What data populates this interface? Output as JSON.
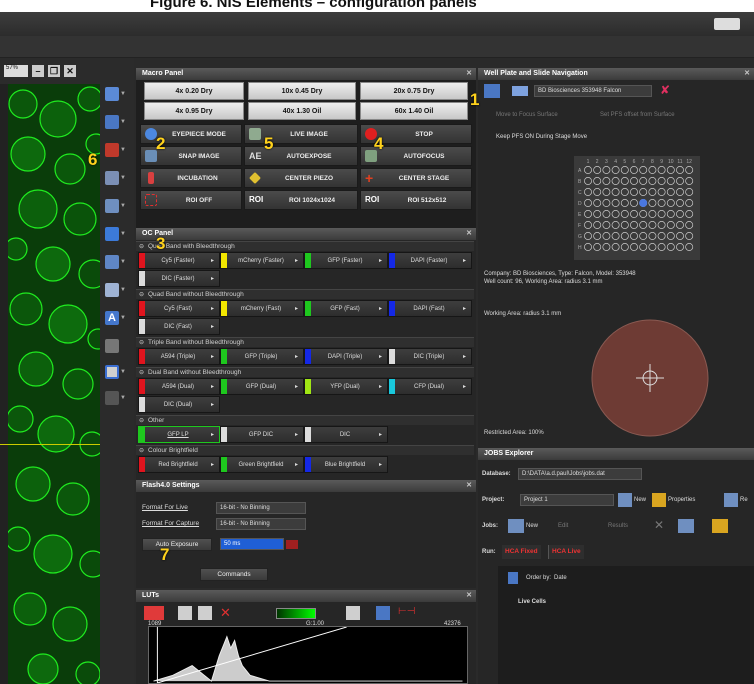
{
  "page_title": "Figure 6. NIS Elements – configuration panels",
  "viewer": {
    "zoom": "57%"
  },
  "macro_panel": {
    "title": "Macro Panel",
    "objectives": [
      "4x 0.20 Dry",
      "10x 0.45 Dry",
      "20x 0.75 Dry",
      "4x 0.95 Dry",
      "40x 1.30 Oil",
      "60x 1.40 Oil"
    ],
    "buttons": [
      "EYEPIECE MODE",
      "LIVE IMAGE",
      "STOP",
      "SNAP IMAGE",
      "AUTOEXPOSE",
      "AUTOFOCUS",
      "INCUBATION",
      "CENTER PIEZO",
      "CENTER STAGE",
      "ROI OFF",
      "ROI 1024x1024",
      "ROI 512x512"
    ]
  },
  "oc_panel": {
    "title": "OC Panel",
    "groups": [
      {
        "name": "Quad Band with Bleedthrough",
        "channels": [
          "Cy5 (Faster)",
          "mCherry (Faster)",
          "GFP (Faster)",
          "DAPI (Faster)",
          "DIC (Faster)"
        ]
      },
      {
        "name": "Quad Band without Bleedthrough",
        "channels": [
          "Cy5 (Fast)",
          "mCherry (Fast)",
          "GFP (Fast)",
          "DAPI (Fast)",
          "DIC (Fast)"
        ]
      },
      {
        "name": "Triple Band without Bleedthrough",
        "channels": [
          "A594 (Triple)",
          "GFP (Triple)",
          "DAPI (Triple)",
          "DIC (Triple)"
        ]
      },
      {
        "name": "Dual Band without Bleedthrough",
        "channels": [
          "A594 (Dual)",
          "GFP (Dual)",
          "YFP (Dual)",
          "CFP (Dual)",
          "DIC (Dual)"
        ]
      },
      {
        "name": "Other",
        "channels": [
          "GFP LP",
          "GFP DIC",
          "DIC"
        ]
      },
      {
        "name": "Colour Brightfield",
        "channels": [
          "Red Brightfield",
          "Green Brightfield",
          "Blue Brightfield"
        ]
      }
    ]
  },
  "flash_settings": {
    "title": "Flash4.0 Settings",
    "format_live_label": "Format For Live",
    "format_live_value": "16-bit - No Binning",
    "format_capture_label": "Format For Capture",
    "format_capture_value": "16-bit - No Binning",
    "auto_exposure": "Auto Exposure",
    "exposure_value": "50 ms",
    "commands": "Commands"
  },
  "luts": {
    "title": "LUTs",
    "min": "1089",
    "gamma": "G:1.00",
    "max": "42376"
  },
  "well_plate": {
    "title": "Well Plate and Slide Navigation",
    "plate_select": "BD Biosciences 353948 Falcon",
    "move_to_focus": "Move to Focus Surface",
    "set_pfs": "Set PFS offset from Surface",
    "keep_pfs": "Keep PFS ON During Stage Move",
    "col_labels": [
      "1",
      "2",
      "3",
      "4",
      "5",
      "6",
      "7",
      "8",
      "9",
      "10",
      "11",
      "12"
    ],
    "row_labels": [
      "A",
      "B",
      "C",
      "D",
      "E",
      "F",
      "G",
      "H"
    ],
    "company": "Company: BD Biosciences, Type: Falcon, Model: 353948",
    "well_info": "Well count: 96, Working Area: radius 3.1 mm",
    "working_area": "Working Area: radius 3.1 mm",
    "restricted_area": "Restricted Area: 100%"
  },
  "jobs": {
    "title": "JOBS Explorer",
    "database_label": "Database:",
    "database_value": "D:\\DATA\\a.d.paul\\Jobs\\jobs.dat",
    "project_label": "Project:",
    "project_value": "Project 1",
    "new": "New",
    "properties": "Properties",
    "re": "Re",
    "jobs_label": "Jobs:",
    "edit": "Edit",
    "results": "Results",
    "run_label": "Run:",
    "tab_fixed": "HCA Fixed",
    "tab_live": "HCA Live",
    "order_by": "Order by:",
    "order_value": "Date",
    "group": "Live Cells"
  },
  "annotations": [
    "1",
    "2",
    "3",
    "4",
    "5",
    "6",
    "7"
  ],
  "colors": {
    "red": "#e0141e",
    "yellow": "#f2e600",
    "green": "#1ec81e",
    "blue": "#1428e6",
    "cyan": "#19c8dc",
    "lime": "#a0e614",
    "white": "#dcdcdc",
    "accent": "#ffd21c"
  }
}
